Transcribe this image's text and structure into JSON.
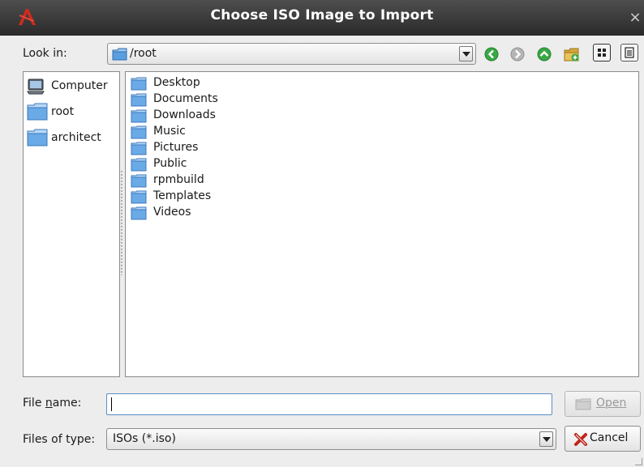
{
  "window": {
    "title": "Choose ISO Image to Import",
    "close_glyph": "×"
  },
  "look_in": {
    "label": "Look in:",
    "path": "/root"
  },
  "toolbar": {
    "icons": [
      "back-icon",
      "forward-icon",
      "parent-directory-icon",
      "new-folder-icon",
      "icon-view-icon",
      "detail-view-icon"
    ]
  },
  "sidebar": {
    "items": [
      {
        "label": "Computer",
        "icon": "computer-icon"
      },
      {
        "label": "root",
        "icon": "folder-icon"
      },
      {
        "label": "architect",
        "icon": "folder-icon"
      }
    ]
  },
  "files": [
    {
      "name": "Desktop"
    },
    {
      "name": "Documents"
    },
    {
      "name": "Downloads"
    },
    {
      "name": "Music"
    },
    {
      "name": "Pictures"
    },
    {
      "name": "Public"
    },
    {
      "name": "rpmbuild"
    },
    {
      "name": "Templates"
    },
    {
      "name": "Videos"
    }
  ],
  "file_name": {
    "label_prefix": "File ",
    "label_mnemonic": "n",
    "label_suffix": "ame:",
    "value": ""
  },
  "files_of_type": {
    "label": "Files of type:",
    "value": "ISOs (*.iso)"
  },
  "buttons": {
    "open_mnemonic": "O",
    "open_rest": "pen",
    "cancel": "Cancel"
  },
  "colors": {
    "titlebar": "#3a3a3a",
    "folder": "#4a8fd4",
    "accent_green": "#2e9b3a",
    "cancel_red": "#c0241b"
  }
}
